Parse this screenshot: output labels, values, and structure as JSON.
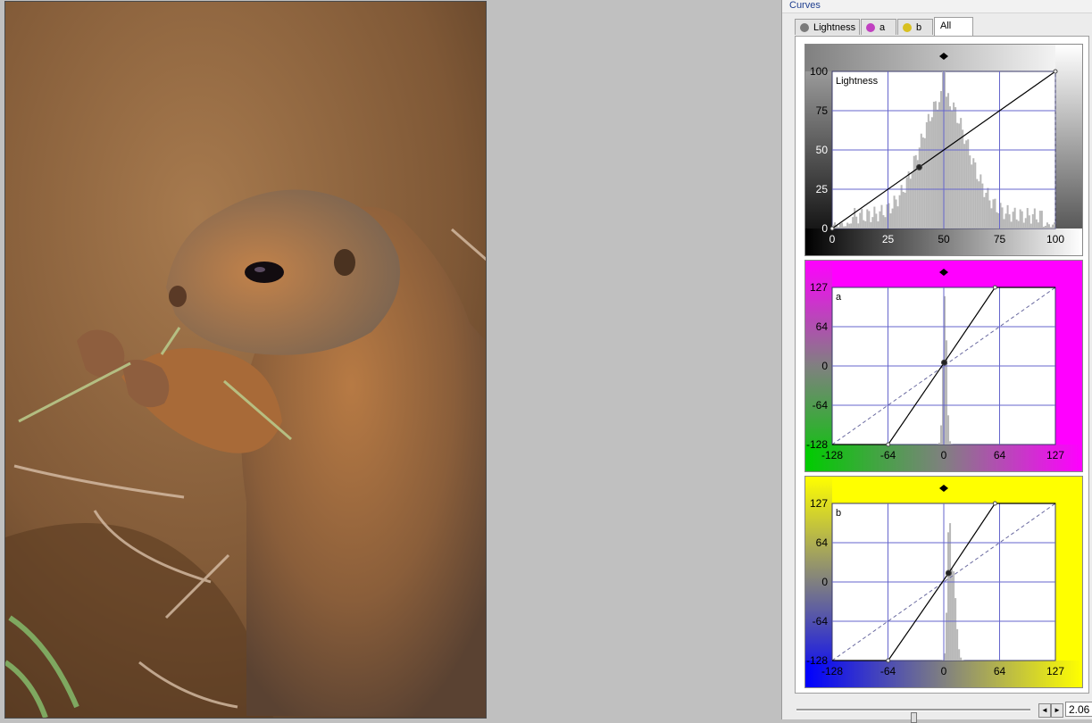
{
  "panel": {
    "title": "Curves",
    "tabs": [
      {
        "label": "Lightness",
        "icon": "lightness-dot-icon",
        "color": "#7a7a7a"
      },
      {
        "label": "a",
        "icon": "a-channel-dot-icon",
        "color": "#c040c0"
      },
      {
        "label": "b",
        "icon": "b-channel-dot-icon",
        "color": "#d8c020"
      },
      {
        "label": "All",
        "icon": "",
        "color": ""
      }
    ],
    "active_tab": "All"
  },
  "curves": {
    "lightness": {
      "label": "Lightness",
      "y_ticks": [
        "100",
        "75",
        "50",
        "25",
        "0"
      ],
      "x_ticks": [
        "0",
        "25",
        "50",
        "75",
        "100"
      ],
      "range": [
        0,
        100
      ],
      "points": [
        [
          0,
          0
        ],
        [
          39,
          39
        ],
        [
          100,
          100
        ]
      ]
    },
    "a": {
      "label": "a",
      "y_ticks": [
        "127",
        "64",
        "0",
        "-64",
        "-128"
      ],
      "x_ticks": [
        "-128",
        "-64",
        "0",
        "64",
        "127"
      ],
      "range": [
        -128,
        127
      ],
      "points": [
        [
          -64,
          -128
        ],
        [
          0,
          5
        ],
        [
          58,
          127
        ]
      ]
    },
    "b": {
      "label": "b",
      "y_ticks": [
        "127",
        "64",
        "0",
        "-64",
        "-128"
      ],
      "x_ticks": [
        "-128",
        "-64",
        "0",
        "64",
        "127"
      ],
      "range": [
        -128,
        127
      ],
      "points": [
        [
          -64,
          -128
        ],
        [
          5,
          14
        ],
        [
          58,
          127
        ]
      ]
    }
  },
  "statusbar": {
    "zoom_value": "2.06",
    "slider_level": 0.5,
    "left_arrow": "◄",
    "right_arrow": "►"
  },
  "colors": {
    "a_positive": "#ff00ff",
    "a_negative": "#00cc00",
    "b_positive": "#ffff00",
    "b_negative": "#0000ff",
    "grid": "#6666cc"
  }
}
